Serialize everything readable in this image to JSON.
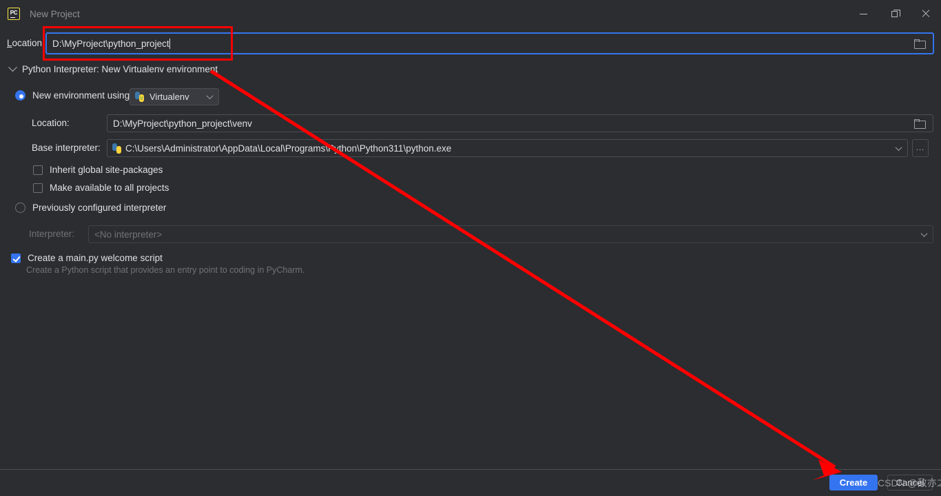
{
  "window": {
    "title": "New Project",
    "app_icon": "pycharm-logo-icon",
    "logo_text": "PC",
    "controls": {
      "minimize": "minimize-icon",
      "maximize": "restore-icon",
      "close": "close-icon"
    }
  },
  "location": {
    "label_prefix": "L",
    "label_rest": "ocation",
    "value": "D:\\MyProject\\python_project",
    "browse_icon": "folder-icon"
  },
  "interpreter_section": {
    "header": "Python Interpreter: New Virtualenv environment",
    "collapse_icon": "chevron-down-icon"
  },
  "new_env": {
    "radio_label": "New environment using",
    "radio_selected": true,
    "env_type": "Virtualenv",
    "env_icon": "python-virtualenv-icon",
    "dropdown_icon": "chevron-down-icon",
    "location_label": "Location:",
    "location_value": "D:\\MyProject\\python_project\\venv",
    "location_browse_icon": "folder-icon",
    "base_label": "Base interpreter:",
    "base_value": "C:\\Users\\Administrator\\AppData\\Local\\Programs\\Python\\Python311\\python.exe",
    "base_icon": "python-icon",
    "base_dropdown_icon": "chevron-down-icon",
    "base_more_button": "...",
    "checkbox_inherit": "Inherit global site-packages",
    "checkbox_inherit_checked": false,
    "checkbox_available": "Make available to all projects",
    "checkbox_available_checked": false
  },
  "previous_env": {
    "radio_label": "Previously configured interpreter",
    "radio_selected": false,
    "interpreter_label": "Interpreter:",
    "interpreter_value": "<No interpreter>",
    "interpreter_dropdown_icon": "chevron-down-icon"
  },
  "main_script": {
    "checkbox_label": "Create a main.py welcome script",
    "checked": true,
    "hint": "Create a Python script that provides an entry point to coding in PyCharm."
  },
  "footer": {
    "create_label": "Create",
    "cancel_label": "Cancel"
  },
  "annotations": {
    "watermark": "CSDN @敌亦之",
    "highlight_color": "#ff0000",
    "accent_color": "#3574f0",
    "background_color": "#2b2d30"
  }
}
